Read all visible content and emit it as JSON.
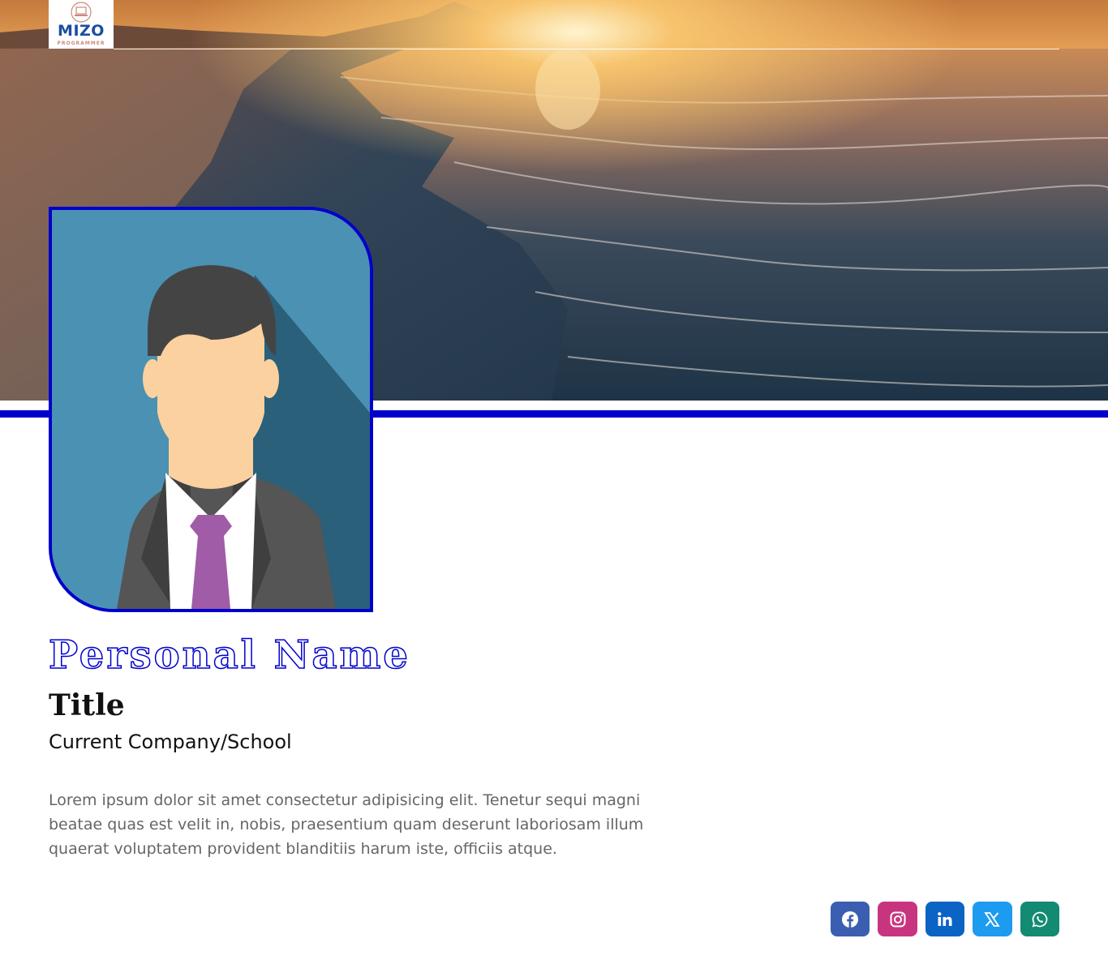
{
  "header": {
    "logo_text": "MIZO",
    "logo_subtext": "PROGRAMMER"
  },
  "profile": {
    "name": "Personal Name",
    "title": "Title",
    "company": "Current Company/School",
    "bio": "Lorem ipsum dolor sit amet consectetur adipisicing elit. Tenetur sequi magni beatae quas est velit in, nobis, praesentium quam deserunt laboriosam illum quaerat voluptatem provident blanditiis harum iste, officiis atque."
  },
  "colors": {
    "accent": "#0000cc",
    "name_fill": "#ffffff",
    "avatar_bg": "#4a91b3",
    "tie": "#a05ca6"
  },
  "socials": [
    {
      "name": "facebook",
      "icon": "facebook-icon",
      "color": "#3b5eb0"
    },
    {
      "name": "instagram",
      "icon": "instagram-icon",
      "color": "#c8357f"
    },
    {
      "name": "linkedin",
      "icon": "linkedin-icon",
      "color": "#0b63c4"
    },
    {
      "name": "x",
      "icon": "x-icon",
      "color": "#1d9bf0"
    },
    {
      "name": "whatsapp",
      "icon": "whatsapp-icon",
      "color": "#138a72"
    }
  ]
}
